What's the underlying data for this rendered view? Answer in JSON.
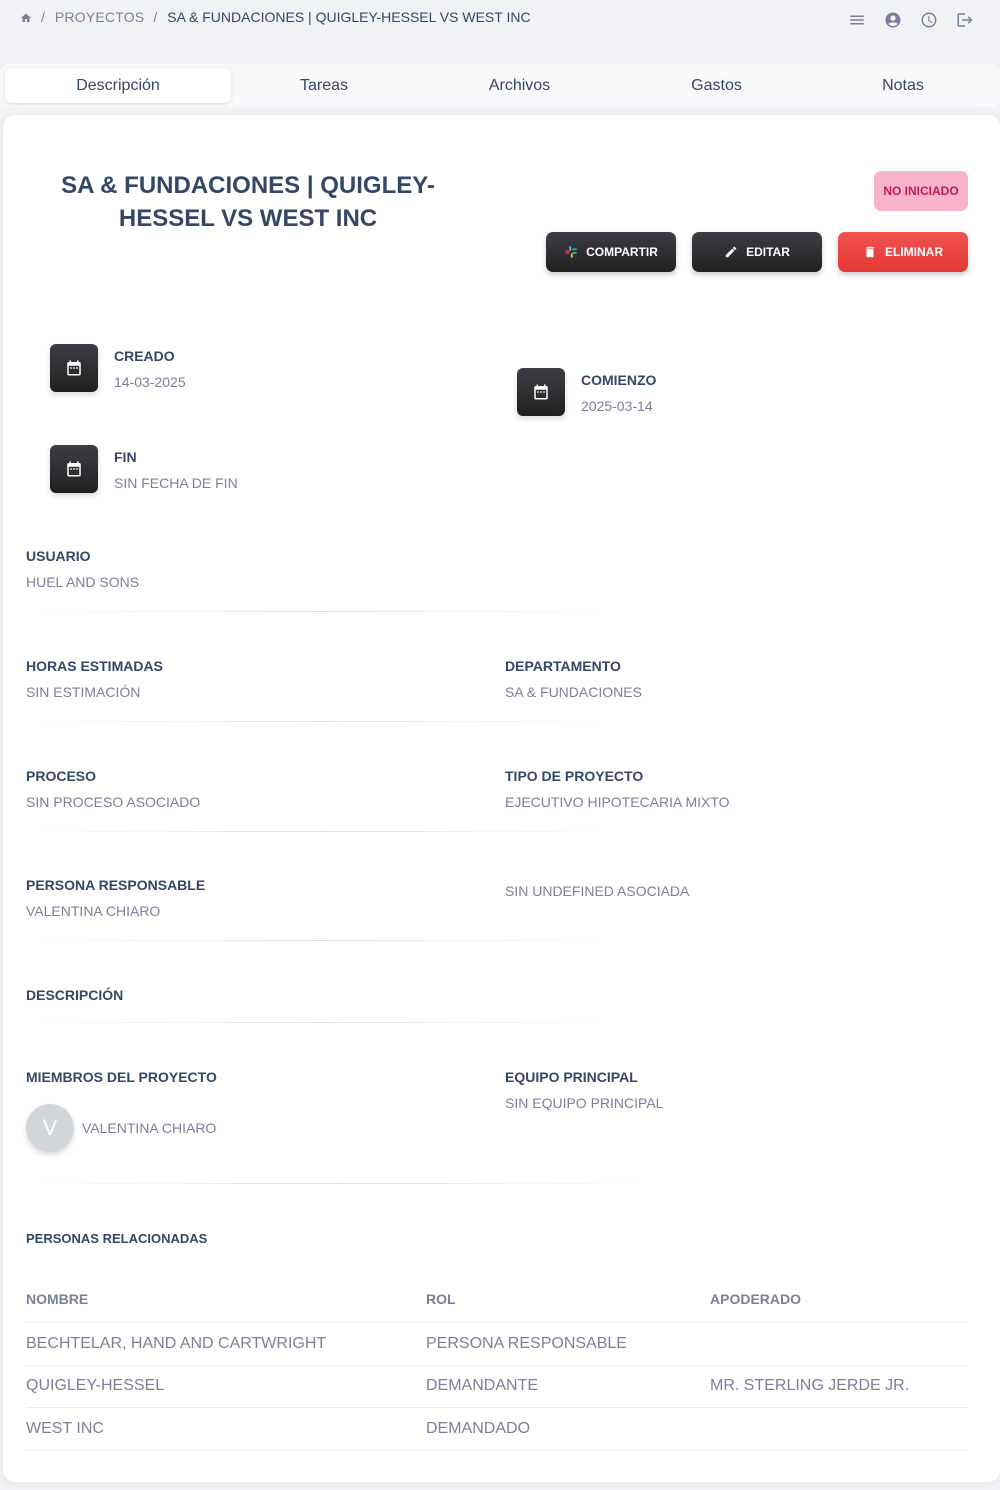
{
  "breadcrumb": {
    "section": "PROYECTOS",
    "current": "SA & FUNDACIONES | QUIGLEY-HESSEL VS WEST INC"
  },
  "top_icons": [
    "menu-icon",
    "account-icon",
    "history-icon",
    "logout-icon"
  ],
  "tabs": [
    {
      "label": "Descripción",
      "active": true
    },
    {
      "label": "Tareas"
    },
    {
      "label": "Archivos"
    },
    {
      "label": "Gastos"
    },
    {
      "label": "Notas"
    }
  ],
  "project": {
    "title": "SA & FUNDACIONES | QUIGLEY-HESSEL VS WEST INC",
    "status": "NO INICIADO"
  },
  "actions": {
    "share": "COMPARTIR",
    "edit": "EDITAR",
    "delete": "ELIMINAR"
  },
  "dates": {
    "created_label": "CREADO",
    "created_value": "14-03-2025",
    "start_label": "COMIENZO",
    "start_value": "2025-03-14",
    "end_label": "FIN",
    "end_value": "SIN FECHA DE FIN"
  },
  "fields": {
    "user_label": "USUARIO",
    "user_value": "HUEL AND SONS",
    "hours_label": "HORAS ESTIMADAS",
    "hours_value": "SIN ESTIMACIÓN",
    "department_label": "DEPARTAMENTO",
    "department_value": "SA & FUNDACIONES",
    "process_label": "PROCESO",
    "process_value": "SIN PROCESO ASOCIADO",
    "type_label": "TIPO DE PROYECTO",
    "type_value": "EJECUTIVO HIPOTECARIA MIXTO",
    "responsible_label": "PERSONA RESPONSABLE",
    "responsible_value": "VALENTINA CHIARO",
    "undefined_value": "SIN UNDEFINED ASOCIADA",
    "description_label": "DESCRIPCIÓN",
    "members_label": "MIEMBROS DEL PROYECTO",
    "team_label": "EQUIPO PRINCIPAL",
    "team_value": "SIN EQUIPO PRINCIPAL"
  },
  "members": [
    {
      "initial": "V",
      "name": "VALENTINA CHIARO"
    }
  ],
  "related": {
    "title": "PERSONAS RELACIONADAS",
    "headers": [
      "NOMBRE",
      "ROL",
      "APODERADO"
    ],
    "rows": [
      [
        "BECHTELAR, HAND AND CARTWRIGHT",
        "PERSONA RESPONSABLE",
        ""
      ],
      [
        "QUIGLEY-HESSEL",
        "DEMANDANTE",
        "MR. STERLING JERDE JR."
      ],
      [
        "WEST INC",
        "DEMANDADO",
        ""
      ]
    ]
  },
  "colors": {
    "primary_text": "#344767",
    "secondary_text": "#7b809a",
    "danger": "#e53935",
    "status_bg": "#f8b4c9",
    "status_text": "#c2185b"
  }
}
